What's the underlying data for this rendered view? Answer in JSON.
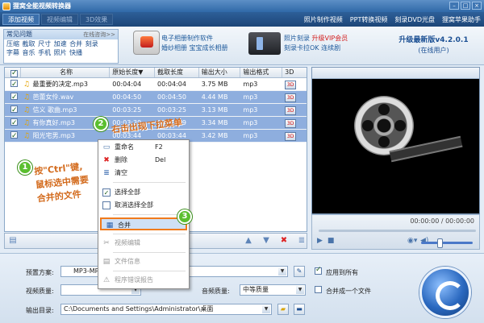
{
  "app": {
    "title": "狸窝全能视频转换器"
  },
  "nav": {
    "left_tabs": [
      "添加视频",
      "视频编辑",
      "3D效果"
    ],
    "right_links": [
      "照片制作视频",
      "PPT转换视频",
      "刻录DVD光盘",
      "狸窝苹果助手"
    ]
  },
  "faq": {
    "title": "常见问题",
    "more": "在线咨询>>",
    "row1": "压缩 截取 尺寸 加速 合并 刻录",
    "row2": "字幕 音乐 手机 照片 快播"
  },
  "ads": {
    "ad1_line1": "电子相册制作软件",
    "ad1_line2": "婚纱相册  宝宝成长相册",
    "ad2_line1_a": "照片刻录 ",
    "ad2_line1_b": "升级VIP会员",
    "ad2_line2": "刻录卡拉OK 连续剧"
  },
  "version": {
    "title": "升级最新版v4.2.0.1",
    "subtitle": "(在线用户)"
  },
  "columns": [
    "名称",
    "原始长度▼",
    "截取长度",
    "输出大小",
    "输出格式",
    "3D"
  ],
  "rows": [
    {
      "name": "最重要的决定.mp3",
      "orig": "00:04:04",
      "cut": "00:04:04",
      "size": "3.75 MB",
      "fmt": "mp3",
      "sel": false
    },
    {
      "name": "芭蕾女伶.wav",
      "orig": "00:04:50",
      "cut": "00:04:50",
      "size": "4.44 MB",
      "fmt": "mp3",
      "sel": true
    },
    {
      "name": "信义 歌曲.mp3",
      "orig": "00:03:25",
      "cut": "00:03:25",
      "size": "3.13 MB",
      "fmt": "mp3",
      "sel": true
    },
    {
      "name": "有你真好.mp3",
      "orig": "00:03:39",
      "cut": "00:03:39",
      "size": "3.34 MB",
      "fmt": "mp3",
      "sel": true
    },
    {
      "name": "阳光宅男.mp3",
      "orig": "00:03:44",
      "cut": "00:03:44",
      "size": "3.42 MB",
      "fmt": "mp3",
      "sel": true
    }
  ],
  "preview": {
    "time": "00:00:00 / 00:00:00"
  },
  "settings": {
    "preset_label": "预置方案:",
    "preset_value": "MP3-MPEG",
    "vq_label": "视频质量:",
    "aq_label": "音频质量:",
    "aq_value": "中等质量",
    "out_label": "输出目录:",
    "out_value": "C:\\Documents and Settings\\Administrator\\桌面",
    "apply_all": "应用到所有",
    "merge_one": "合并成一个文件"
  },
  "menu": {
    "rename": "重命名",
    "rename_key": "F2",
    "delete": "删除",
    "delete_key": "Del",
    "clear": "清空",
    "select_all": "选择全部",
    "unselect_all": "取消选择全部",
    "merge": "合并",
    "video_edit": "视频编辑",
    "file_info": "文件信息",
    "error_report": "程序错误报告"
  },
  "annotations": {
    "step1_line1": "按\"Ctrl\"键,",
    "step1_line2": "鼠标选中需要",
    "step1_line3": "合并的文件",
    "step2": "右击出现下拉菜单",
    "n1": "1",
    "n2": "2",
    "n3": "3"
  },
  "colors": {
    "accent": "#2f69a8",
    "highlight": "#f07a1b",
    "annotation": "#d36b1d",
    "selected_row": "#8eaede"
  }
}
